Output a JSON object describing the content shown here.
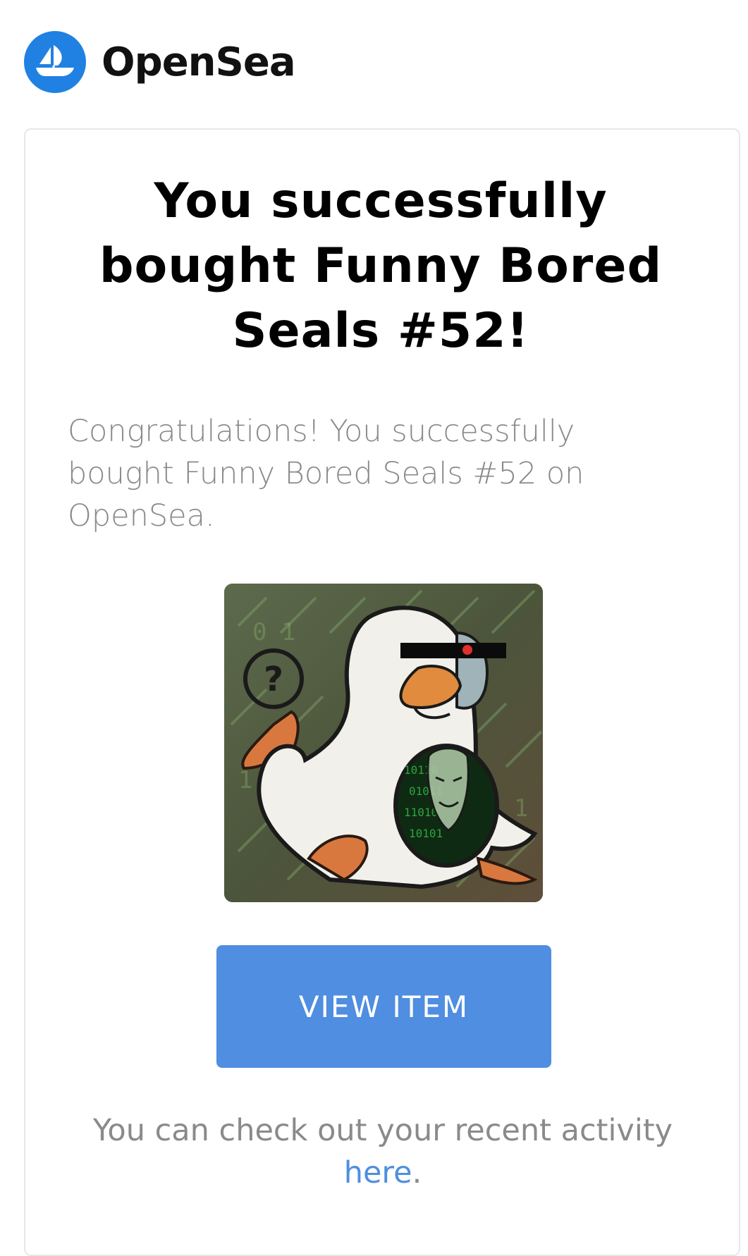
{
  "header": {
    "brand": "OpenSea",
    "logo_icon": "opensea-ship-logo-icon",
    "brand_color": "#2081e2"
  },
  "card": {
    "headline": "You successfully bought Funny Bored Seals #52!",
    "message": "Congratulations! You successfully bought Funny Bored Seals #52 on OpenSea.",
    "image": {
      "icon": "nft-seal-artwork"
    },
    "button_label": "VIEW ITEM",
    "button_color": "#4f8ee0",
    "footer_text": "You can check out your recent activity",
    "footer_link_label": "here",
    "footer_end": "."
  }
}
